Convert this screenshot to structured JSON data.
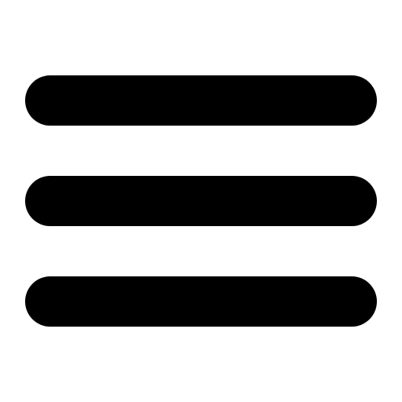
{
  "icon": {
    "name": "hamburger-menu-icon",
    "color": "#000000",
    "background": "#ffffff",
    "bar_count": 3
  }
}
